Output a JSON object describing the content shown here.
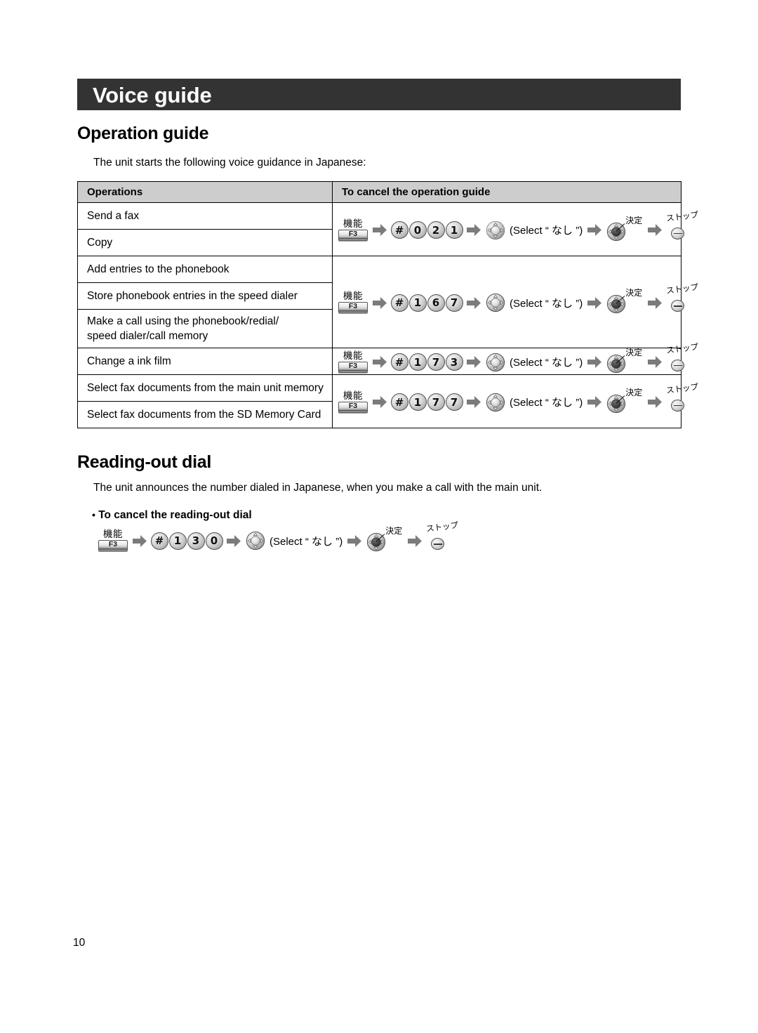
{
  "document": {
    "chapter_title": "Voice guide",
    "page_number": "10"
  },
  "sections": [
    {
      "heading": "Operation guide",
      "intro": "The unit starts the following voice guidance in Japanese:"
    },
    {
      "heading": "Reading-out dial",
      "intro": "The unit announces the number dialed in Japanese, when you make a call with the main unit.",
      "bullet_heading": "To cancel the  reading-out dial"
    }
  ],
  "table": {
    "headers": [
      "Operations",
      "To cancel the operation guide"
    ],
    "operations": [
      "Send a fax",
      "Copy",
      "Add entries to the phonebook",
      "Store phonebook entries in the speed dialer",
      "Make a call using the phonebook/redial/\nspeed dialer/call memory",
      "Change a ink film",
      "Select fax documents from the main unit memory",
      "Select fax documents from the SD Memory Card"
    ],
    "operations_flat": {
      "r1": "Send a fax",
      "r2": "Copy",
      "r3": "Add entries to the phonebook",
      "r4": "Store phonebook entries in the speed dialer",
      "r5a": "Make a call using the phonebook/redial/",
      "r5b": "speed dialer/call memory",
      "r6": "Change a ink film",
      "r7": "Select fax documents from the main unit memory",
      "r8": "Select fax documents from the SD Memory Card"
    },
    "sequences": [
      {
        "digits": [
          "#",
          "0",
          "2",
          "1"
        ],
        "spans_rows": 2
      },
      {
        "digits": [
          "#",
          "1",
          "6",
          "7"
        ],
        "spans_rows": 3
      },
      {
        "digits": [
          "#",
          "1",
          "7",
          "3"
        ],
        "spans_rows": 1
      },
      {
        "digits": [
          "#",
          "1",
          "7",
          "7"
        ],
        "spans_rows": 2
      }
    ],
    "sequences_flat": {
      "s1": {
        "d1": "#",
        "d2": "0",
        "d3": "2",
        "d4": "1"
      },
      "s2": {
        "d1": "#",
        "d2": "1",
        "d3": "6",
        "d4": "7"
      },
      "s3": {
        "d1": "#",
        "d2": "1",
        "d3": "7",
        "d4": "3"
      },
      "s4": {
        "d1": "#",
        "d2": "1",
        "d3": "7",
        "d4": "7"
      }
    }
  },
  "reading_out_sequence": {
    "d1": "#",
    "d2": "1",
    "d3": "3",
    "d4": "0"
  },
  "keys": {
    "function_label_jp": "機能",
    "function_key_label": "F3",
    "ok_label_jp": "決定",
    "stop_label_jp": "ストップ",
    "select_prefix": "(Select “ ",
    "select_value_jp": "なし",
    "select_suffix": " ”)",
    "navigator_icon": "navigator-pad-icon",
    "arrow_icon": "right-arrow-icon"
  },
  "colors": {
    "banner_background": "#333333",
    "table_header_background": "#cdcdcd",
    "border": "#000000",
    "arrow_fill": "#7b7b7b",
    "text": "#000000"
  }
}
